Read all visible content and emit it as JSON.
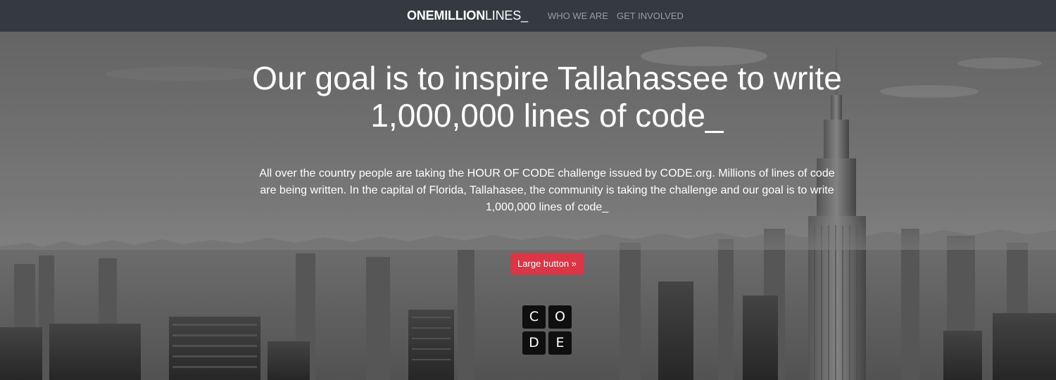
{
  "navbar": {
    "brand_bold": "ONEMILLION",
    "brand_light": "LINES_",
    "links": [
      "WHO WE ARE",
      "GET INVOLVED"
    ]
  },
  "hero": {
    "headline": "Our goal is to inspire Tallahassee to write 1,000,000 lines of code_",
    "lead": "All over the country people are taking the HOUR OF CODE challenge issued by CODE.org. Millions of lines of code are being written. In the capital of Florida, Tallahasee, the community is taking the challenge and our goal is to write 1,000,000 lines of code_",
    "button_label": "Large button »"
  },
  "code_logo": {
    "letters": [
      "C",
      "O",
      "D",
      "E"
    ]
  },
  "colors": {
    "navbar_bg": "#343a40",
    "nav_link": "#9a9da1",
    "button_bg": "#dc3545"
  }
}
